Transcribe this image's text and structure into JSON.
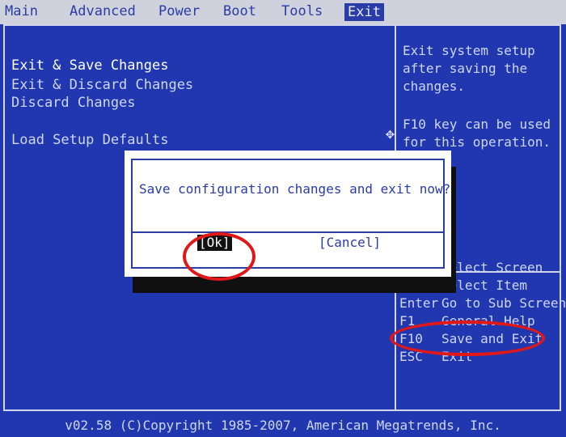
{
  "menu": {
    "items": [
      "Main",
      "Advanced",
      "Power",
      "Boot",
      "Tools",
      "Exit"
    ],
    "active_index": 5
  },
  "options": [
    "Exit & Save Changes",
    "Exit & Discard Changes",
    "Discard Changes",
    "Load Setup Defaults"
  ],
  "help": {
    "description": "Exit system setup\nafter saving the\nchanges.",
    "hint": "F10 key can be used\nfor this operation."
  },
  "keys": [
    {
      "key": "←→",
      "action": "Select Screen"
    },
    {
      "key": "↑↓",
      "action": "Select Item"
    },
    {
      "key": "Enter",
      "action": "Go to Sub Screen"
    },
    {
      "key": "F1",
      "action": "General Help"
    },
    {
      "key": "F10",
      "action": "Save and Exit"
    },
    {
      "key": "ESC",
      "action": "Exit"
    }
  ],
  "dialog": {
    "message": "Save configuration changes and exit now?",
    "ok_label": "[Ok]",
    "cancel_label": "[Cancel]"
  },
  "footer": "v02.58 (C)Copyright 1985-2007, American Megatrends, Inc.",
  "colors": {
    "bios_blue": "#2037b0",
    "menu_gray": "#cfd2dc",
    "annotation_red": "#e01818"
  },
  "icons": {
    "cursor": "move-cursor-icon"
  }
}
